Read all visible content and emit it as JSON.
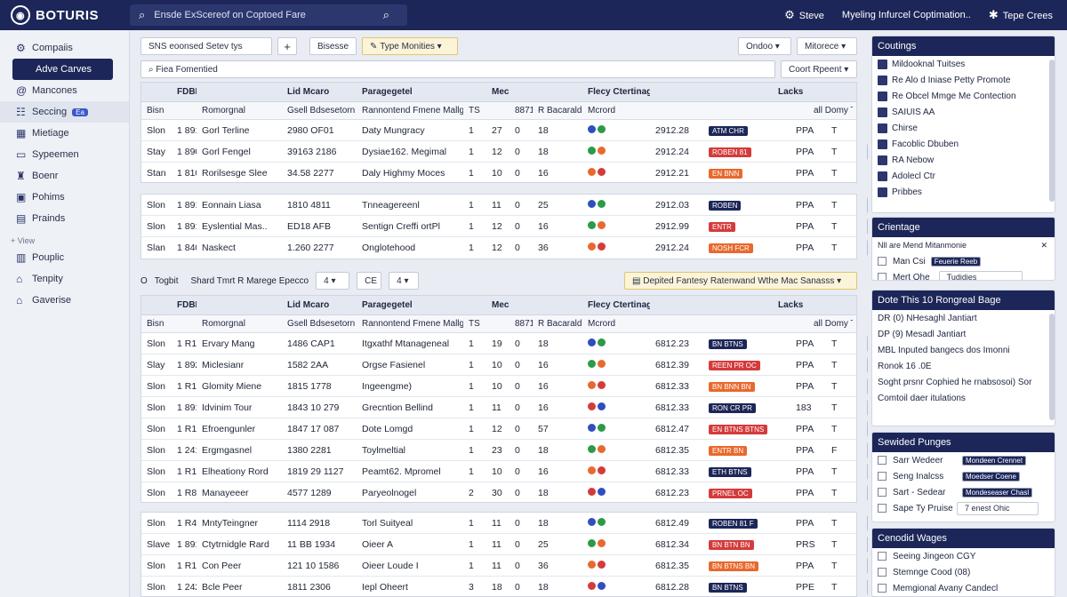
{
  "topbar": {
    "logo": "BOTURIS",
    "search_text": "Ensde ExScereof on Coptoed Fare",
    "links": [
      "Steve",
      "Myeling Infurcel Coptimation..",
      "Tepe Crees"
    ]
  },
  "sidebar": {
    "items": [
      "Compaiis",
      "Adve Carves",
      "Mancones",
      "Seccing",
      "Mietiage",
      "Sypeemen",
      "Boenr",
      "Pohims",
      "Prainds"
    ],
    "section": "View",
    "items2": [
      "Pouplic",
      "Tenpity",
      "Gaverise"
    ],
    "badge": "Ea"
  },
  "toolbar": {
    "filter": "SNS eoonsed Setev tys",
    "plus": "+",
    "btn2": "Bisesse",
    "btn3": "Type Monities",
    "right1": "Ondoo",
    "right2": "Mitorece",
    "search": "Fiea Fomentied",
    "sort": "Coort Rpeent"
  },
  "header": {
    "cols": [
      "",
      "FDBRI Mecihtins",
      "",
      "Lid Mcaro",
      "Paragegetel",
      "",
      "Mecde",
      "",
      "",
      "Flecy Ctertinage..",
      "",
      "",
      "Lacks",
      "",
      ""
    ]
  },
  "subheader": {
    "cols": [
      "Bisn",
      "",
      "Romorgnal",
      "Gsell Bdsesetorn",
      "Rannontend Fmene Mallgrulle",
      "TS",
      "",
      "8871 1875",
      "R Bacaraldls",
      "Mcrord",
      "",
      "",
      "",
      "all Domy Ts"
    ]
  },
  "group1": [
    [
      "Slon",
      "1 891",
      "Gorl Terline",
      "2980 OF01",
      "Daty Mungracy",
      "1",
      "27",
      "0",
      "18",
      "2912.28",
      "ATM CHR",
      "PPA",
      "T",
      ""
    ],
    [
      "Stay",
      "1 890",
      "Gorl Fengel",
      "39163 2186",
      "Dysiae162. Megimal",
      "1",
      "12",
      "0",
      "18",
      "2912.24",
      "ROBEN 81",
      "PPA",
      "T",
      "FA"
    ],
    [
      "Stan",
      "1 810",
      "Rorilsesge Slee",
      "34.58 2277",
      "Daly Highmy Moces",
      "1",
      "10",
      "0",
      "16",
      "2912.21",
      "EN BNN",
      "PPA",
      "T",
      ""
    ]
  ],
  "group2": [
    [
      "Slon",
      "1 891",
      "Eonnain Liasa",
      "1810 4811",
      "Tnneagereenl",
      "1",
      "11",
      "0",
      "25",
      "2912.03",
      "ROBEN",
      "PPA",
      "T",
      "ED"
    ],
    [
      "Slon",
      "1 891",
      "Eyslential Mas..",
      "ED18 AFB",
      "Sentign Creffi ortPl",
      "1",
      "12",
      "0",
      "16",
      "2912.99",
      "ENTR",
      "PPA",
      "T",
      "MA"
    ],
    [
      "Slan",
      "1 840",
      "Naskect",
      "1.260 2277",
      "Onglotehood",
      "1",
      "12",
      "0",
      "36",
      "2912.24",
      "NOSH FCR",
      "PPA",
      "T",
      "YY"
    ]
  ],
  "mid": {
    "icon": "O",
    "label": "Togbit",
    "desc": "Shard Tmrt R Marege Epecco",
    "num": "4",
    "code": "CE",
    "num2": "4",
    "banner": "Depited Fantesy Ratenwand Wthe Mac Sanasss"
  },
  "group3": [
    [
      "Slon",
      "1 R10",
      "Ervary Mang",
      "1486 CAP1",
      "Itgxathf Mtanageneal",
      "1",
      "19",
      "0",
      "18",
      "6812.23",
      "BN BTNS",
      "PPA",
      "T",
      "E"
    ],
    [
      "Slay",
      "1 892",
      "Miclesianr",
      "1582 2AA",
      "Orgse Fasienel",
      "1",
      "10",
      "0",
      "16",
      "6812.39",
      "REEN PR OC",
      "PPA",
      "T",
      "E"
    ],
    [
      "Slon",
      "1 R10",
      "Glomity Miene",
      "1815 1778",
      "Ingeengme)",
      "1",
      "10",
      "0",
      "16",
      "6812.33",
      "BN BNN BN",
      "PPA",
      "T",
      "+"
    ],
    [
      "Slon",
      "1 891",
      "Idvinim Tour",
      "1843 10 279",
      "Grecntion Bellind",
      "1",
      "11",
      "0",
      "16",
      "6812.33",
      "RON CR PR",
      "183",
      "T",
      "E"
    ],
    [
      "Slon",
      "1 R10",
      "Efroengunler",
      "1847 17 087",
      "Dote Lomgd",
      "1",
      "12",
      "0",
      "57",
      "6812.47",
      "EN BTNS BTNS",
      "PPA",
      "T",
      "E"
    ],
    [
      "Slon",
      "1 241",
      "Ergmgasnel",
      "1380 2281",
      "Toylmeltial",
      "1",
      "23",
      "0",
      "18",
      "6812.35",
      "ENTR BN",
      "PPA",
      "F",
      "E"
    ],
    [
      "Slon",
      "1 R10",
      "Elheationy Rord",
      "1819 29 1127",
      "Peamt62. Mpromel",
      "1",
      "10",
      "0",
      "16",
      "6812.33",
      "ETH BTNS",
      "PPA",
      "T",
      "E"
    ],
    [
      "Slon",
      "1 R80",
      "Manayeeer",
      "4577 1289",
      "Paryeolnogel",
      "2",
      "30",
      "0",
      "18",
      "6812.23",
      "PRNEL OC",
      "PPA",
      "T",
      "E"
    ]
  ],
  "group4": [
    [
      "Slon",
      "1 R41",
      "MntyTeingner",
      "1114 2918",
      "Torl Suityeal",
      "1",
      "11",
      "0",
      "18",
      "6812.49",
      "ROBEN 81 F",
      "PPA",
      "T",
      "+"
    ],
    [
      "Slave",
      "1 891",
      "Ctytrnidgle Rard",
      "11 BB 1934",
      "Oieer A",
      "1",
      "11",
      "0",
      "25",
      "6812.34",
      "BN BTN BN",
      "PRS",
      "T",
      "+"
    ],
    [
      "Slon",
      "1 R11",
      "Con Peer",
      "121 10 1586",
      "Oieer Loude I",
      "1",
      "11",
      "0",
      "36",
      "6812.35",
      "BN BTNS BN",
      "PPA",
      "T",
      "E"
    ],
    [
      "Slon",
      "1 242",
      "Bcle Peer",
      "1811 2306",
      "Iepl Oheert",
      "3",
      "18",
      "0",
      "18",
      "6812.28",
      "BN BTNS",
      "PPE",
      "T",
      "E"
    ]
  ],
  "right": {
    "card1": {
      "title": "Coutings",
      "items": [
        "Mildooknal Tuitses",
        "Re Alo d Iniase Petty Promote",
        "Re Obcel Mmge Me Contection",
        "SAIUIS AA",
        "Chirse",
        "Facoblic Dbuben",
        "RA Nebow",
        "Adolecl Ctr",
        "Pribbes"
      ]
    },
    "card2": {
      "title": "Crientage",
      "desc": "Nll are Mend Mitanmonie",
      "items": [
        "Man Csi",
        "Mert Ohe"
      ],
      "tag": "Feuerie Reeb",
      "field": "Tudidies"
    },
    "card3": {
      "title": "Dote This 10 Rongreal Bage",
      "lines": [
        "DR (0) NHesaghl Jantiart",
        "DP (9) Mesadl Jantiart",
        "MBL Inputed bangecs dos Imonni",
        "Ronok 16 .0E",
        "Soght prsnr Cophied he rnabsosoi) Sor",
        "Comtoil daer itulations"
      ]
    },
    "card4": {
      "title": "Sewided Punges",
      "items": [
        "Sarr Wedeer",
        "Seng Inalcss",
        "Sart - Sedear",
        "Sape Ty Pruise"
      ],
      "tags": [
        "Mondeen Crennet",
        "Moedser Coene",
        "Mondeseaser Chasl"
      ],
      "field": "7 enest Ohic"
    },
    "card5": {
      "title": "Cenodid Wages",
      "items": [
        "Seeing Jingeon CGY",
        "Stemnge Cood (08)",
        "Memgional Avany Candecl"
      ]
    }
  },
  "colors": {
    "navy": "#1c2658",
    "accent": "#3c58c8",
    "red": "#d43b3b",
    "orange": "#e8692e",
    "blue": "#2f4fc0",
    "green": "#2c9a4a"
  }
}
